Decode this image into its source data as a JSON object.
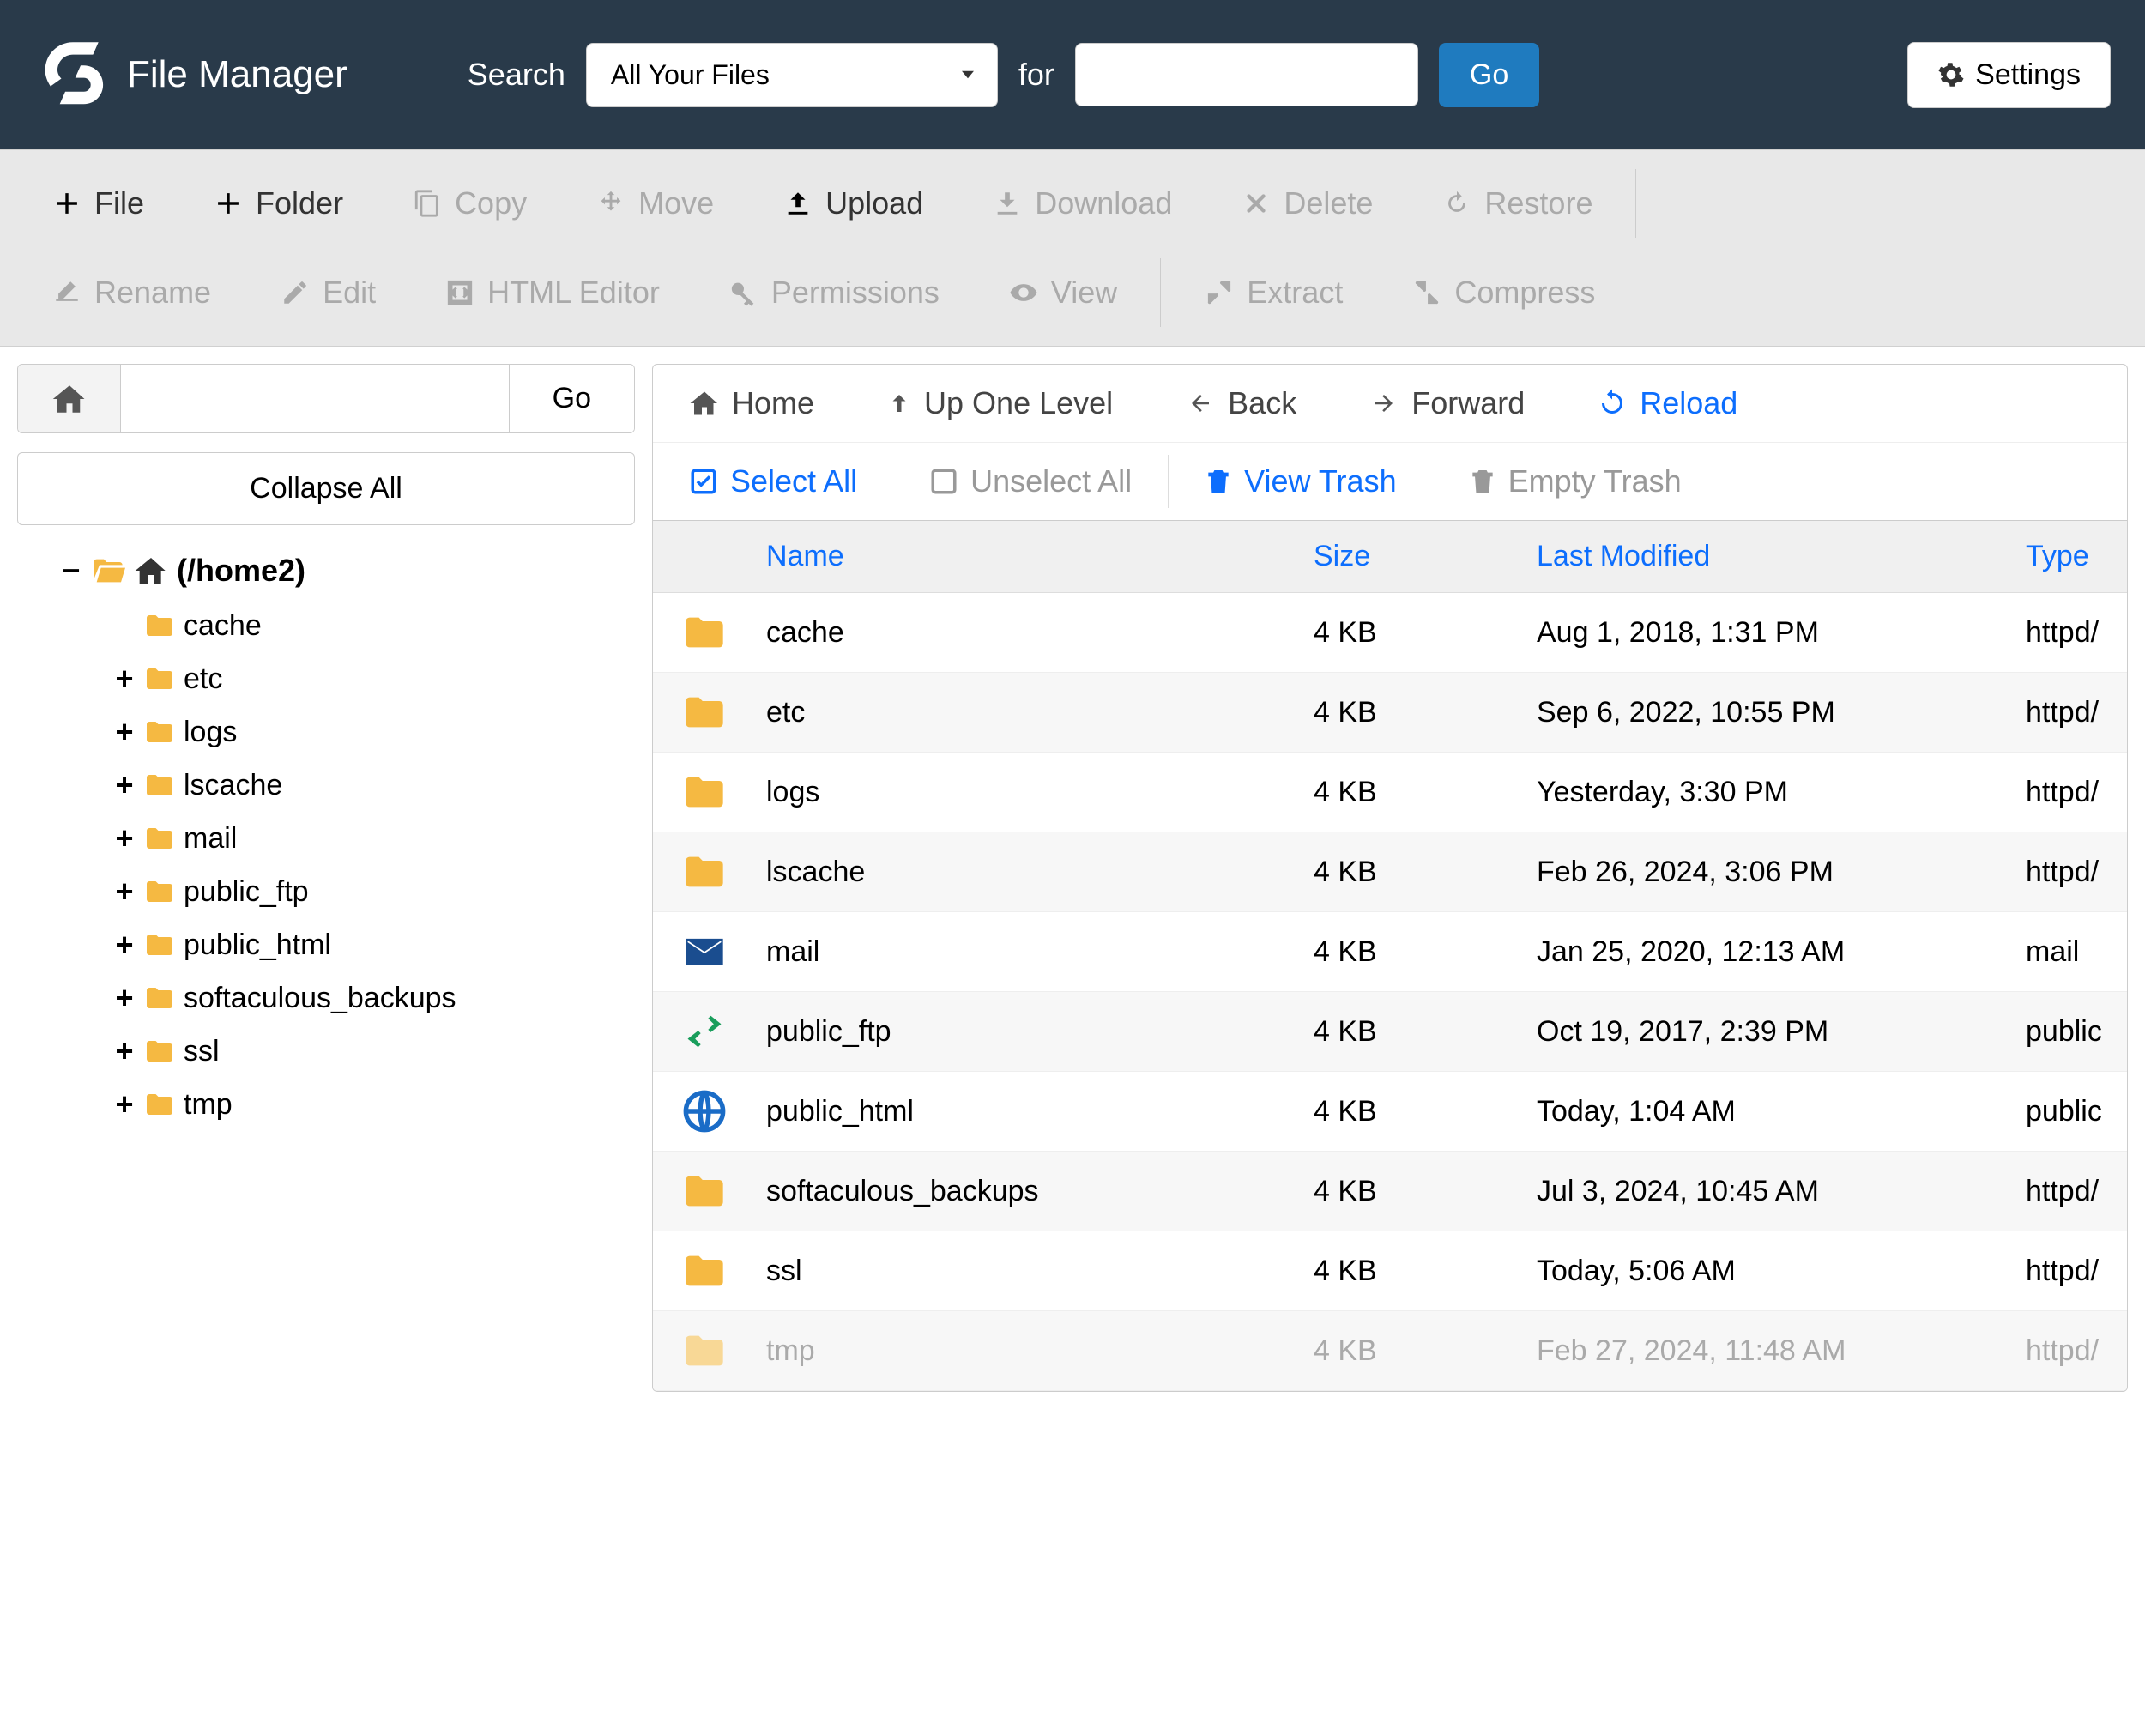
{
  "header": {
    "app_title": "File Manager",
    "search_label": "Search",
    "search_select_value": "All Your Files",
    "for_label": "for",
    "search_input_value": "",
    "go_label": "Go",
    "settings_label": "Settings"
  },
  "toolbar": {
    "file": "File",
    "folder": "Folder",
    "copy": "Copy",
    "move": "Move",
    "upload": "Upload",
    "download": "Download",
    "delete": "Delete",
    "restore": "Restore",
    "rename": "Rename",
    "edit": "Edit",
    "html_editor": "HTML Editor",
    "permissions": "Permissions",
    "view": "View",
    "extract": "Extract",
    "compress": "Compress"
  },
  "tree": {
    "go_label": "Go",
    "collapse_label": "Collapse All",
    "root_label": "(/home2)",
    "items": [
      {
        "label": "cache",
        "expandable": false
      },
      {
        "label": "etc",
        "expandable": true
      },
      {
        "label": "logs",
        "expandable": true
      },
      {
        "label": "lscache",
        "expandable": true
      },
      {
        "label": "mail",
        "expandable": true
      },
      {
        "label": "public_ftp",
        "expandable": true
      },
      {
        "label": "public_html",
        "expandable": true
      },
      {
        "label": "softaculous_backups",
        "expandable": true
      },
      {
        "label": "ssl",
        "expandable": true
      },
      {
        "label": "tmp",
        "expandable": true
      }
    ]
  },
  "file_nav": {
    "home": "Home",
    "up": "Up One Level",
    "back": "Back",
    "forward": "Forward",
    "reload": "Reload",
    "select_all": "Select All",
    "unselect_all": "Unselect All",
    "view_trash": "View Trash",
    "empty_trash": "Empty Trash"
  },
  "columns": {
    "name": "Name",
    "size": "Size",
    "modified": "Last Modified",
    "type": "Type"
  },
  "files": [
    {
      "icon": "folder",
      "name": "cache",
      "size": "4 KB",
      "modified": "Aug 1, 2018, 1:31 PM",
      "type": "httpd/"
    },
    {
      "icon": "folder",
      "name": "etc",
      "size": "4 KB",
      "modified": "Sep 6, 2022, 10:55 PM",
      "type": "httpd/"
    },
    {
      "icon": "folder",
      "name": "logs",
      "size": "4 KB",
      "modified": "Yesterday, 3:30 PM",
      "type": "httpd/"
    },
    {
      "icon": "folder",
      "name": "lscache",
      "size": "4 KB",
      "modified": "Feb 26, 2024, 3:06 PM",
      "type": "httpd/"
    },
    {
      "icon": "mail",
      "name": "mail",
      "size": "4 KB",
      "modified": "Jan 25, 2020, 12:13 AM",
      "type": "mail"
    },
    {
      "icon": "ftp",
      "name": "public_ftp",
      "size": "4 KB",
      "modified": "Oct 19, 2017, 2:39 PM",
      "type": "public"
    },
    {
      "icon": "globe",
      "name": "public_html",
      "size": "4 KB",
      "modified": "Today, 1:04 AM",
      "type": "public"
    },
    {
      "icon": "folder",
      "name": "softaculous_backups",
      "size": "4 KB",
      "modified": "Jul 3, 2024, 10:45 AM",
      "type": "httpd/"
    },
    {
      "icon": "folder",
      "name": "ssl",
      "size": "4 KB",
      "modified": "Today, 5:06 AM",
      "type": "httpd/"
    },
    {
      "icon": "folder-faded",
      "name": "tmp",
      "size": "4 KB",
      "modified": "Feb 27, 2024, 11:48 AM",
      "type": "httpd/"
    }
  ]
}
